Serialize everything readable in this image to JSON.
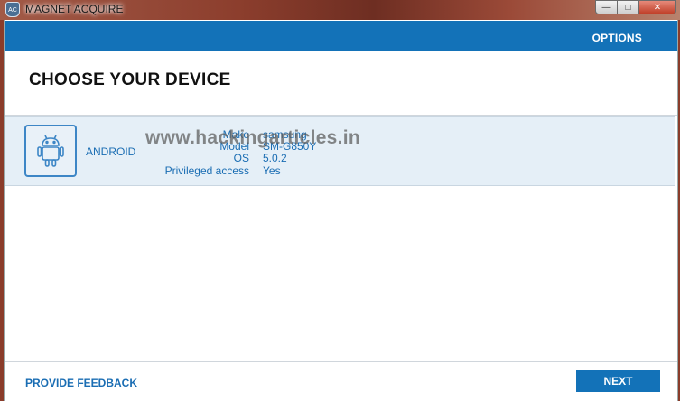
{
  "window": {
    "title": "MAGNET ACQUIRE",
    "app_icon_text": "AC",
    "minimize_glyph": "—",
    "maximize_glyph": "□",
    "close_glyph": "✕"
  },
  "topbar": {
    "options_label": "OPTIONS"
  },
  "page": {
    "heading": "CHOOSE YOUR DEVICE"
  },
  "device": {
    "type": "ANDROID",
    "icon": "android-icon",
    "make_label": "Make",
    "make_value": "samsung",
    "model_label": "Model",
    "model_value": "SM-G850Y",
    "os_label": "OS",
    "os_value": "5.0.2",
    "privileged_label": "Privileged access",
    "privileged_value": "Yes"
  },
  "watermark": "www.hackingarticles.in",
  "footer": {
    "feedback_label": "PROVIDE FEEDBACK",
    "next_label": "NEXT"
  },
  "colors": {
    "accent": "#1372b8",
    "row_selected": "#e5eff7",
    "link": "#1a6db3"
  }
}
